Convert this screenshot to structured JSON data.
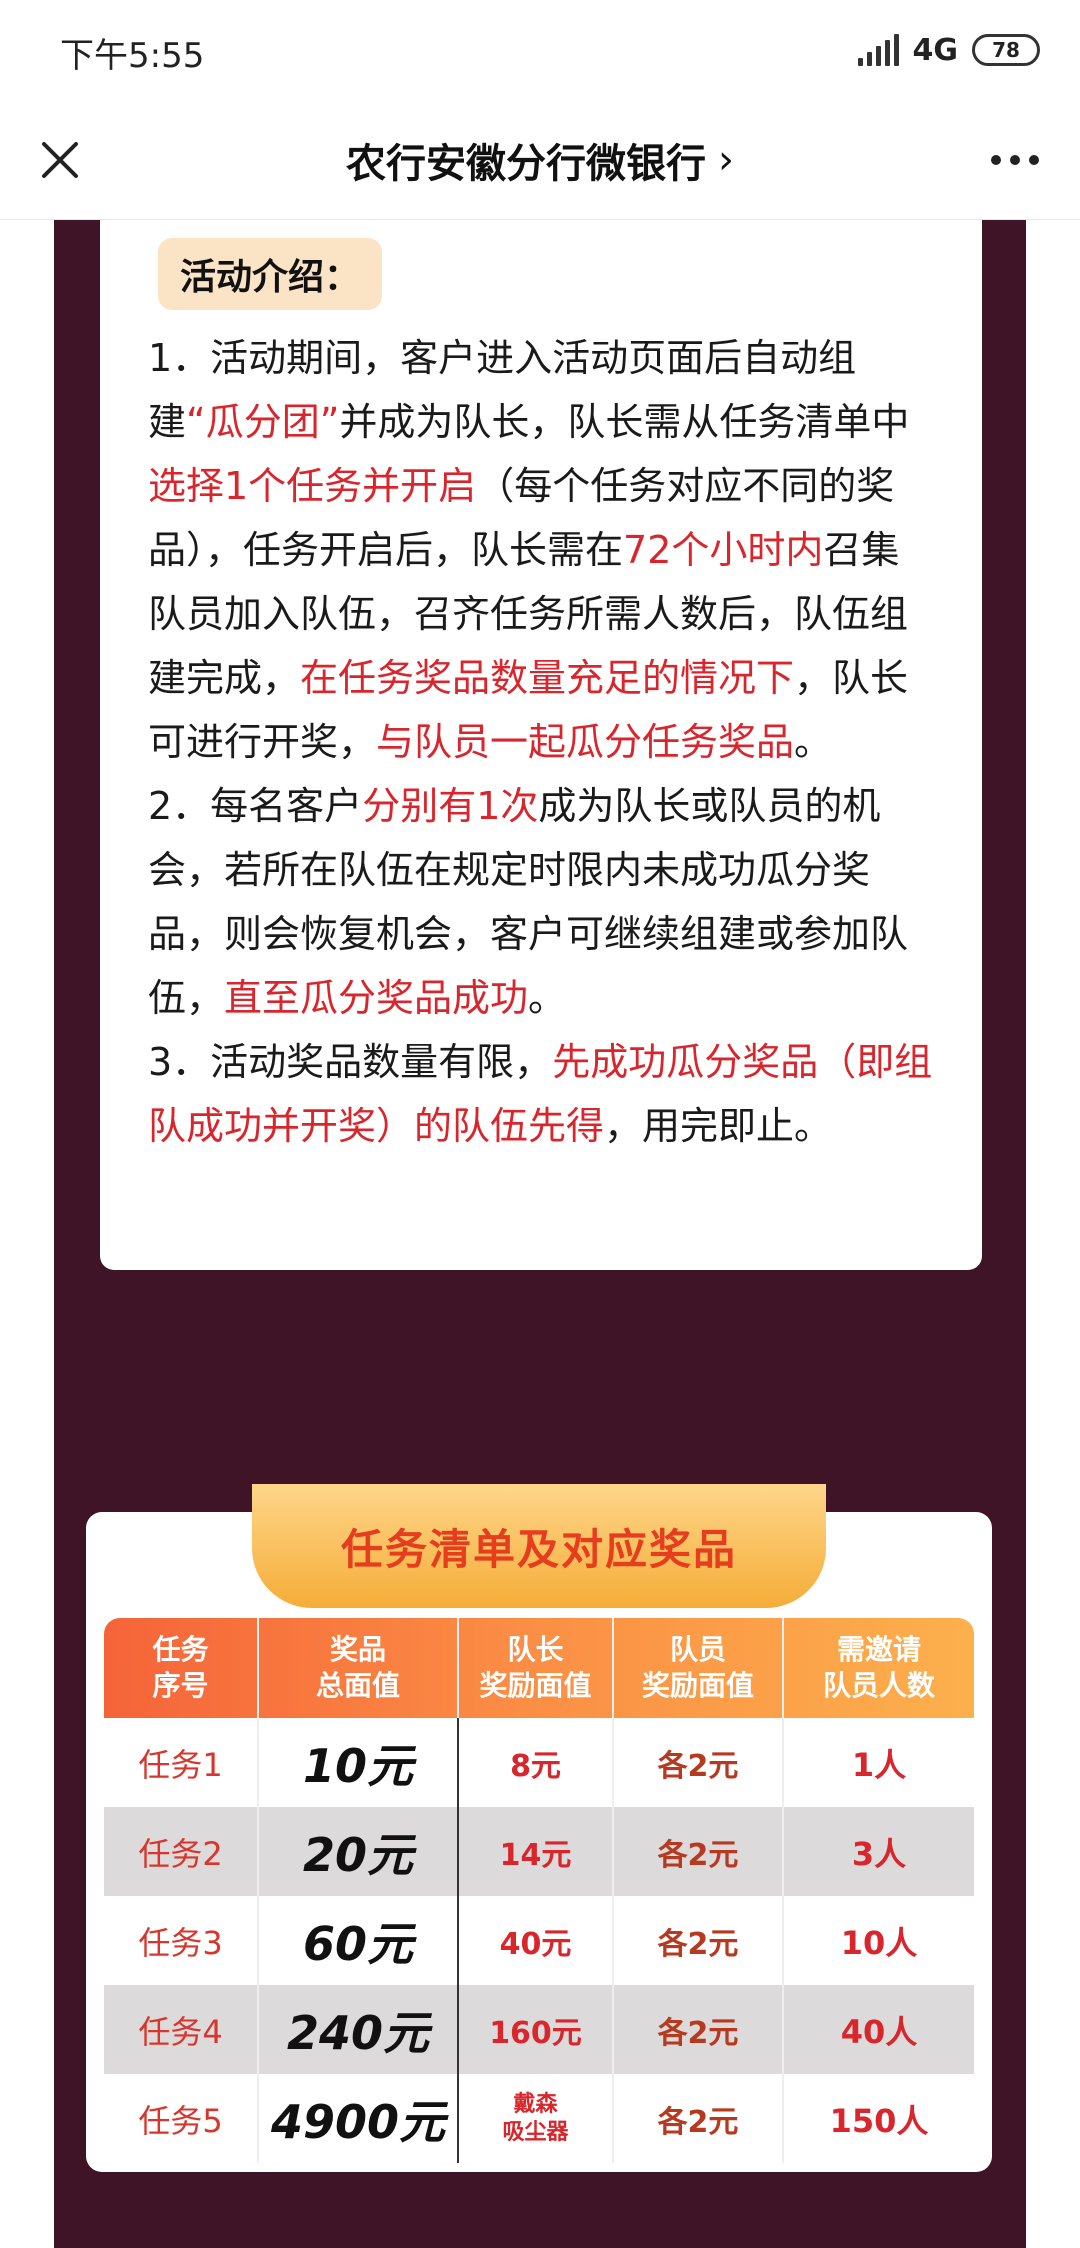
{
  "status": {
    "time": "下午5:55",
    "network": "4G",
    "battery": "78"
  },
  "header": {
    "title": "农行安徽分行微银行",
    "chevron": "›",
    "close_icon": "close-icon",
    "more_icon": "more-icon"
  },
  "intro": {
    "tag": "活动介绍：",
    "segments": [
      {
        "t": "1．活动期间，客户进入活动页面后自动组建",
        "red": false
      },
      {
        "t": "“瓜分团”",
        "red": true
      },
      {
        "t": "并成为队长，队长需从任务清单中",
        "red": false
      },
      {
        "t": "选择1个任务并开启",
        "red": true
      },
      {
        "t": "（每个任务对应不同的奖品），任务开启后，队长需在",
        "red": false
      },
      {
        "t": "72个小时内",
        "red": true
      },
      {
        "t": "召集队员加入队伍，召齐任务所需人数后，队伍组建完成，",
        "red": false
      },
      {
        "t": "在任务奖品数量充足的情况下",
        "red": true
      },
      {
        "t": "，队长可进行开奖，",
        "red": false
      },
      {
        "t": "与队员一起瓜分任务奖品",
        "red": true
      },
      {
        "t": "。",
        "red": false
      },
      {
        "t": "\n2．每名客户",
        "red": false
      },
      {
        "t": "分别有1次",
        "red": true
      },
      {
        "t": "成为队长或队员的机会，若所在队伍在规定时限内未成功瓜分奖品，则会恢复机会，客户可继续组建或参加队伍，",
        "red": false
      },
      {
        "t": "直至瓜分奖品成功",
        "red": true
      },
      {
        "t": "。",
        "red": false
      },
      {
        "t": "\n3．活动奖品数量有限，",
        "red": false
      },
      {
        "t": "先成功瓜分奖品（即组队成功并开奖）的队伍先得",
        "red": true
      },
      {
        "t": "，用完即止。",
        "red": false
      }
    ]
  },
  "tasks": {
    "title": "任务清单及对应奖品",
    "headers": [
      [
        "任务",
        "序号"
      ],
      [
        "奖品",
        "总面值"
      ],
      [
        "队长",
        "奖励面值"
      ],
      [
        "队员",
        "奖励面值"
      ],
      [
        "需邀请",
        "队员人数"
      ]
    ],
    "rows": [
      {
        "no": "任务1",
        "total": "10元",
        "captain": "8元",
        "member": "各2元",
        "invite": "1人"
      },
      {
        "no": "任务2",
        "total": "20元",
        "captain": "14元",
        "member": "各2元",
        "invite": "3人"
      },
      {
        "no": "任务3",
        "total": "60元",
        "captain": "40元",
        "member": "各2元",
        "invite": "10人"
      },
      {
        "no": "任务4",
        "total": "240元",
        "captain": "160元",
        "member": "各2元",
        "invite": "40人"
      },
      {
        "no": "任务5",
        "total": "4900元",
        "captain": "戴森\n吸尘器",
        "member": "各2元",
        "invite": "150人"
      }
    ]
  },
  "colors": {
    "accent_red": "#d8262c",
    "page_bg": "#3f1426",
    "banner_orange": "#f5ad38"
  }
}
